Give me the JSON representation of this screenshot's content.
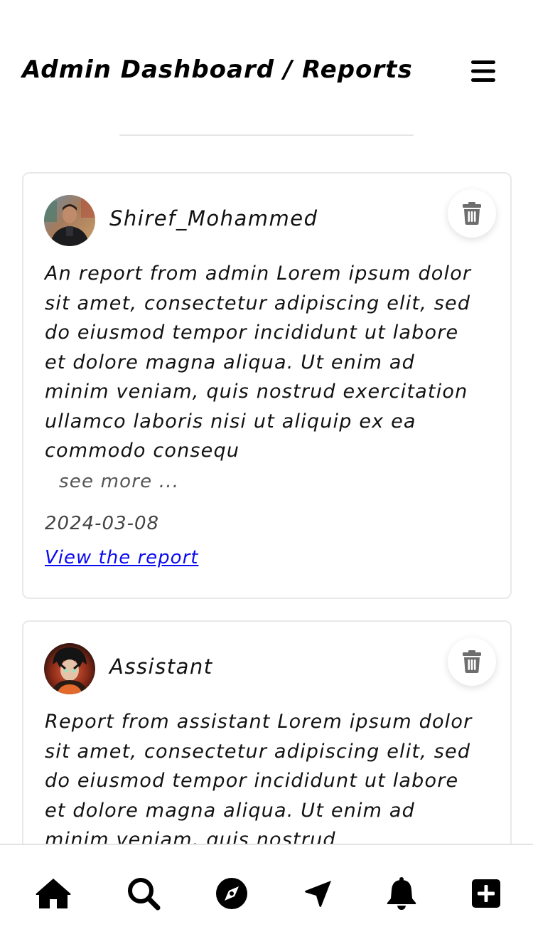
{
  "header": {
    "title": "Admin Dashboard / Reports",
    "menu_icon": "hamburger-menu-icon"
  },
  "reports": [
    {
      "username": "Shiref_Mohammed",
      "body": "An report from admin Lorem ipsum dolor sit amet, consectetur adipiscing elit, sed do eiusmod tempor incididunt ut labore et dolore magna aliqua. Ut enim ad minim veniam, quis nostrud exercitation ullamco laboris nisi ut aliquip ex ea commodo consequ",
      "see_more": "see more ...",
      "date": "2024-03-08",
      "link_label": "View the report",
      "delete_icon": "trash-icon"
    },
    {
      "username": "Assistant",
      "body": "Report from assistant Lorem ipsum dolor sit amet, consectetur adipiscing elit, sed do eiusmod tempor incididunt ut labore et dolore magna aliqua. Ut enim ad minim veniam, quis nostrud",
      "delete_icon": "trash-icon"
    }
  ],
  "bottom_nav": [
    {
      "icon": "home-icon"
    },
    {
      "icon": "search-icon"
    },
    {
      "icon": "compass-icon"
    },
    {
      "icon": "location-arrow-icon"
    },
    {
      "icon": "bell-icon"
    },
    {
      "icon": "plus-square-icon"
    }
  ],
  "colors": {
    "link": "#0a0af0",
    "card_border": "#e9e9e9",
    "icon": "#000000",
    "trash": "#6e6e6e"
  }
}
